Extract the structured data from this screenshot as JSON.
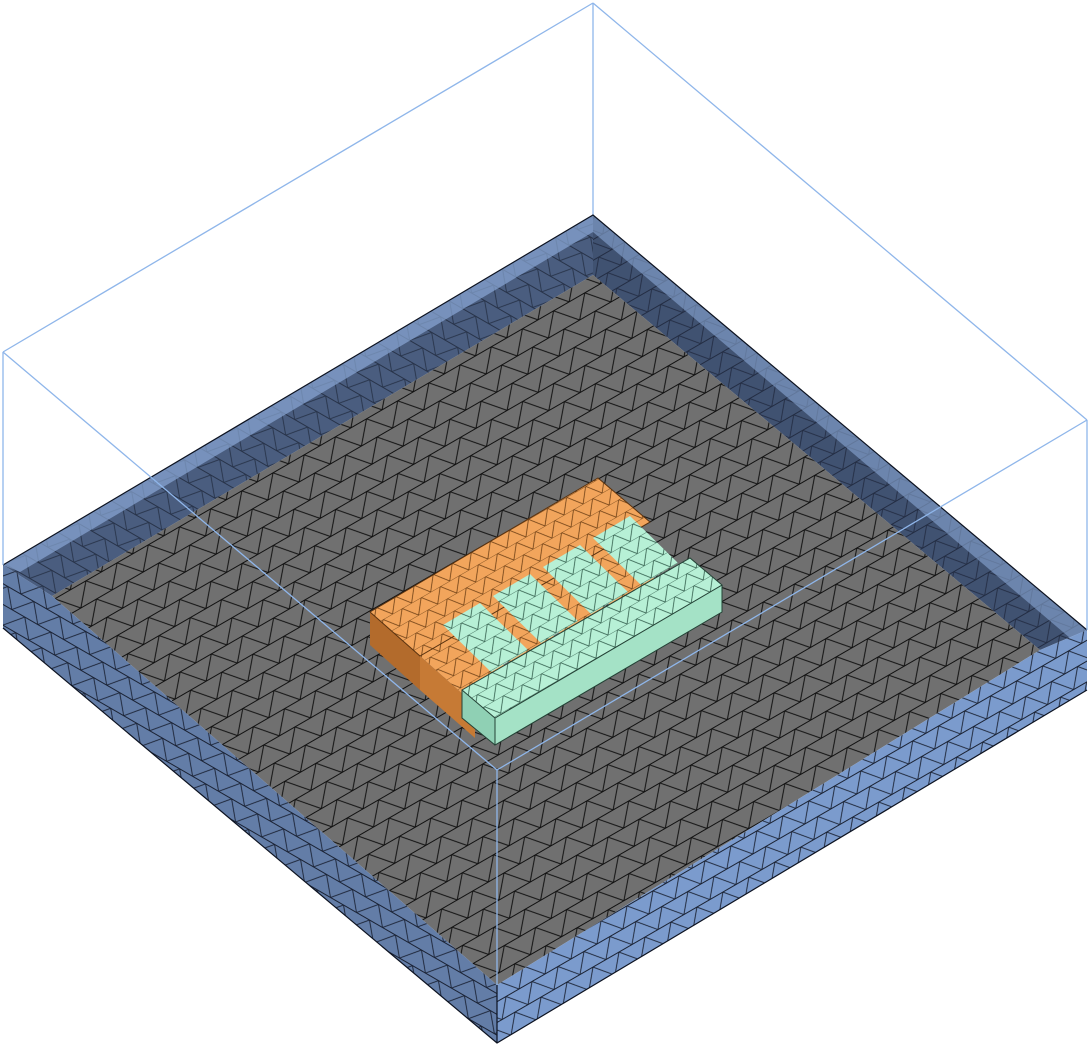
{
  "scene": {
    "description_visible_text": "",
    "colors": {
      "background": "#ffffff",
      "substrate_top": "#6f6f6f",
      "substrate_side_light": "#7f9ed0",
      "substrate_side_dark": "#2e3b52",
      "mesh_line": "#000000",
      "air_box_edge": "#8fb6ea",
      "electrode_a": "#f2a55c",
      "electrode_a_dark": "#b86f2f",
      "electrode_b": "#b8f2d8",
      "electrode_b_dark": "#7fc2a6"
    },
    "objects": [
      "air-box",
      "substrate-block",
      "electrode-a",
      "electrode-b"
    ]
  }
}
